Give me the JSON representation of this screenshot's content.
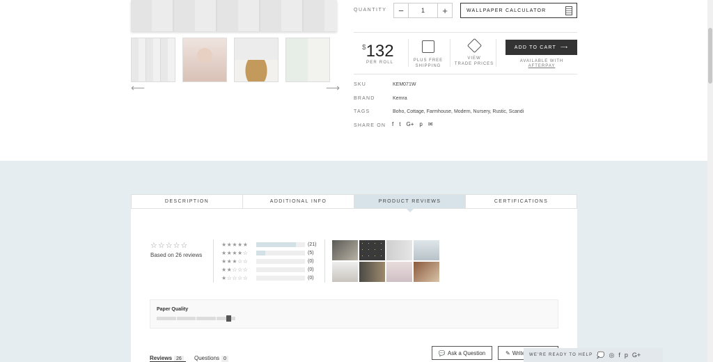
{
  "purchase": {
    "quantity_label": "QUANTITY",
    "quantity_value": "1",
    "minus": "−",
    "plus": "+",
    "calculator_label": "WALLPAPER CALCULATOR",
    "currency": "$",
    "price": "132",
    "per_roll": "PER ROLL",
    "free_shipping_line1": "PLUS FREE",
    "free_shipping_line2": "SHIPPING",
    "trade_line1": "VIEW",
    "trade_line2": "TRADE PRICES",
    "add_to_cart": "ADD TO CART",
    "afterpay_line1": "AVAILABLE WITH",
    "afterpay_line2": "AFTERPAY"
  },
  "gallery": {
    "prev_arrow": "⟵",
    "next_arrow": "⟶"
  },
  "meta": {
    "sku_label": "SKU",
    "sku_value": "KEM071W",
    "brand_label": "BRAND",
    "brand_value": "Kemra",
    "tags_label": "TAGS",
    "tags_value": "Boho, Cottage, Farmhouse, Modern, Nursery, Rustic, Scandi",
    "share_label": "SHARE ON",
    "share_icons": [
      "f",
      "t",
      "G+",
      "p",
      "✉"
    ]
  },
  "tabs": [
    "DESCRIPTION",
    "ADDITIONAL INFO",
    "PRODUCT REVIEWS",
    "CERTIFICATIONS"
  ],
  "reviews": {
    "average_stars": "☆☆☆☆☆",
    "based_on": "Based on 26 reviews",
    "distribution": [
      {
        "stars": "★★★★★",
        "count": "(21)",
        "fraction": 0.81
      },
      {
        "stars": "★★★★☆",
        "count": "(5)",
        "fraction": 0.19
      },
      {
        "stars": "★★★☆☆",
        "count": "(0)",
        "fraction": 0
      },
      {
        "stars": "★★☆☆☆",
        "count": "(0)",
        "fraction": 0
      },
      {
        "stars": "★☆☆☆☆",
        "count": "(0)",
        "fraction": 0
      }
    ],
    "paper_quality_label": "Paper Quality",
    "paper_quality_level": 0.9,
    "reviews_tab": "Reviews",
    "reviews_count": "26",
    "questions_tab": "Questions",
    "questions_count": "0",
    "ask_button": "Ask a Question",
    "write_button": "Write a Review"
  },
  "help_bar": {
    "text": "WE'RE READY TO HELP",
    "icons": [
      "◎",
      "f",
      "p",
      "G+"
    ]
  }
}
